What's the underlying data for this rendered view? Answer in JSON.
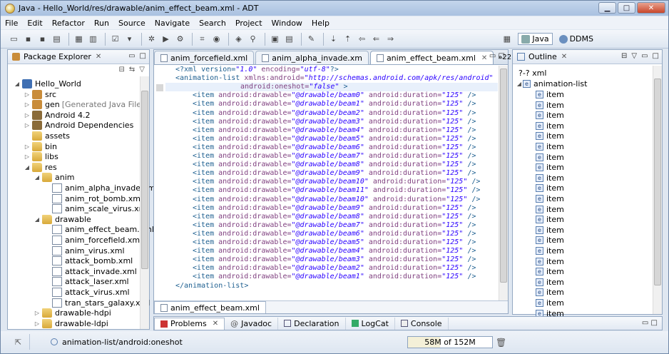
{
  "window": {
    "title": "Java - Hello_World/res/drawable/anim_effect_beam.xml - ADT"
  },
  "menu": [
    "File",
    "Edit",
    "Refactor",
    "Run",
    "Source",
    "Navigate",
    "Search",
    "Project",
    "Window",
    "Help"
  ],
  "perspectives": {
    "java": "Java",
    "ddms": "DDMS"
  },
  "explorer": {
    "title": "Package Explorer",
    "items": [
      {
        "label": "Hello_World",
        "extra": "",
        "icon": "project-icon"
      },
      {
        "label": "src",
        "extra": "",
        "icon": "package-folder-icon"
      },
      {
        "label": "gen",
        "extra": "[Generated Java Files]",
        "icon": "package-folder-icon"
      },
      {
        "label": "Android 4.2",
        "extra": "",
        "icon": "library-icon"
      },
      {
        "label": "Android Dependencies",
        "extra": "",
        "icon": "library-icon"
      },
      {
        "label": "assets",
        "extra": "",
        "icon": "folder-icon"
      },
      {
        "label": "bin",
        "extra": "",
        "icon": "folder-icon"
      },
      {
        "label": "libs",
        "extra": "",
        "icon": "folder-icon"
      },
      {
        "label": "res",
        "extra": "",
        "icon": "folder-icon"
      },
      {
        "label": "anim",
        "extra": "",
        "icon": "folder-icon"
      },
      {
        "label": "anim_alpha_invade.xml",
        "extra": "",
        "icon": "xml-file-icon"
      },
      {
        "label": "anim_rot_bomb.xml",
        "extra": "",
        "icon": "xml-file-icon"
      },
      {
        "label": "anim_scale_virus.xml",
        "extra": "",
        "icon": "xml-file-icon"
      },
      {
        "label": "drawable",
        "extra": "",
        "icon": "folder-icon"
      },
      {
        "label": "anim_effect_beam.xml",
        "extra": "",
        "icon": "xml-file-icon"
      },
      {
        "label": "anim_forcefield.xml",
        "extra": "",
        "icon": "xml-file-icon"
      },
      {
        "label": "anim_virus.xml",
        "extra": "",
        "icon": "xml-file-icon"
      },
      {
        "label": "attack_bomb.xml",
        "extra": "",
        "icon": "xml-file-icon"
      },
      {
        "label": "attack_invade.xml",
        "extra": "",
        "icon": "xml-file-icon"
      },
      {
        "label": "attack_laser.xml",
        "extra": "",
        "icon": "xml-file-icon"
      },
      {
        "label": "attack_virus.xml",
        "extra": "",
        "icon": "xml-file-icon"
      },
      {
        "label": "tran_stars_galaxy.xml",
        "extra": "",
        "icon": "xml-file-icon"
      },
      {
        "label": "drawable-hdpi",
        "extra": "",
        "icon": "folder-icon"
      },
      {
        "label": "drawable-ldpi",
        "extra": "",
        "icon": "folder-icon"
      }
    ]
  },
  "editor": {
    "tabs": [
      "anim_forcefield.xml",
      "anim_alpha_invade.xm",
      "anim_effect_beam.xml"
    ],
    "overflow": "22",
    "bottom_tab": "anim_effect_beam.xml",
    "decl": {
      "pre": "<?xml version=",
      "v1": "\"1.0\"",
      "mid": " encoding=",
      "v2": "\"utf-8\"",
      "post": "?>"
    },
    "root_open": {
      "tag": "<animation-list",
      "attr": " xmlns:android=",
      "val": "\"http://schemas.android.com/apk/res/android\""
    },
    "root_attr": {
      "attr": "android:oneshot=",
      "val": "\"false\"",
      "close": " >"
    },
    "item_tag": "<item",
    "attr_drawable": " android:drawable=",
    "attr_duration": " android:duration=",
    "item_close": " />",
    "items": [
      {
        "drawable": "\"@drawable/beam0\"",
        "duration": "\"125\""
      },
      {
        "drawable": "\"@drawable/beam1\"",
        "duration": "\"125\""
      },
      {
        "drawable": "\"@drawable/beam2\"",
        "duration": "\"125\""
      },
      {
        "drawable": "\"@drawable/beam3\"",
        "duration": "\"125\""
      },
      {
        "drawable": "\"@drawable/beam4\"",
        "duration": "\"125\""
      },
      {
        "drawable": "\"@drawable/beam5\"",
        "duration": "\"125\""
      },
      {
        "drawable": "\"@drawable/beam6\"",
        "duration": "\"125\""
      },
      {
        "drawable": "\"@drawable/beam7\"",
        "duration": "\"125\""
      },
      {
        "drawable": "\"@drawable/beam8\"",
        "duration": "\"125\""
      },
      {
        "drawable": "\"@drawable/beam9\"",
        "duration": "\"125\""
      },
      {
        "drawable": "\"@drawable/beam10\"",
        "duration": "\"125\""
      },
      {
        "drawable": "\"@drawable/beam11\"",
        "duration": "\"125\""
      },
      {
        "drawable": "\"@drawable/beam10\"",
        "duration": "\"125\""
      },
      {
        "drawable": "\"@drawable/beam9\"",
        "duration": "\"125\""
      },
      {
        "drawable": "\"@drawable/beam8\"",
        "duration": "\"125\""
      },
      {
        "drawable": "\"@drawable/beam7\"",
        "duration": "\"125\""
      },
      {
        "drawable": "\"@drawable/beam6\"",
        "duration": "\"125\""
      },
      {
        "drawable": "\"@drawable/beam5\"",
        "duration": "\"125\""
      },
      {
        "drawable": "\"@drawable/beam4\"",
        "duration": "\"125\""
      },
      {
        "drawable": "\"@drawable/beam3\"",
        "duration": "\"125\""
      },
      {
        "drawable": "\"@drawable/beam2\"",
        "duration": "\"125\""
      },
      {
        "drawable": "\"@drawable/beam1\"",
        "duration": "\"125\""
      }
    ],
    "root_close": "</animation-list>"
  },
  "outline": {
    "title": "Outline",
    "root_xml": "?-? xml",
    "root": "animation-list",
    "item_label": "item",
    "item_count": 22
  },
  "bottom": {
    "tabs": [
      "Problems",
      "Javadoc",
      "Declaration",
      "LogCat",
      "Console"
    ],
    "javadoc_prefix": "@"
  },
  "status": {
    "message": "animation-list/android:oneshot",
    "heap": "58M of 152M",
    "heap_used_fraction": 0.38
  },
  "colors": {
    "tag": "#1c5e8f",
    "attr": "#7f3f7f",
    "string": "#2a00ff"
  }
}
